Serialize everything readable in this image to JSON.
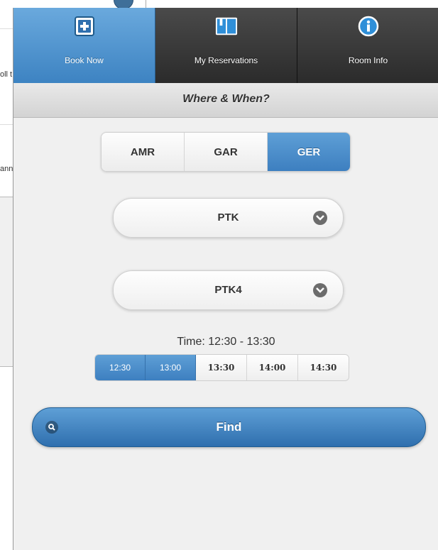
{
  "background": {
    "row1_text": "oll t",
    "row2_text": "ann"
  },
  "nav": {
    "tabs": [
      {
        "label": "Book Now",
        "icon": "plus-square-icon",
        "active": true
      },
      {
        "label": "My Reservations",
        "icon": "book-icon",
        "active": false
      },
      {
        "label": "Room Info",
        "icon": "info-circle-icon",
        "active": false
      }
    ]
  },
  "header": {
    "title": "Where & When?"
  },
  "building_selector": {
    "options": [
      "AMR",
      "GAR",
      "GER"
    ],
    "selected": "GER"
  },
  "select_1": {
    "value": "PTK"
  },
  "select_2": {
    "value": "PTK4"
  },
  "time": {
    "label": "Time: 12:30 - 13:30",
    "slots": [
      {
        "label": "12:30",
        "selected": true
      },
      {
        "label": "13:00",
        "selected": true
      },
      {
        "label": "13:30",
        "selected": false
      },
      {
        "label": "14:00",
        "selected": false
      },
      {
        "label": "14:30",
        "selected": false
      }
    ]
  },
  "find": {
    "label": "Find",
    "icon": "search-icon"
  },
  "colors": {
    "accent": "#4a8fcf",
    "navbar": "#333333",
    "background": "#f0f0f0"
  }
}
